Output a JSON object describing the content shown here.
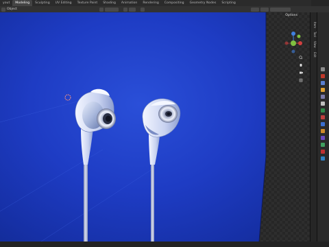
{
  "topbar": {
    "tabs": [
      {
        "label": "yout",
        "active": false
      },
      {
        "label": "Modeling",
        "active": true
      },
      {
        "label": "Sculpting",
        "active": false
      },
      {
        "label": "UV Editing",
        "active": false
      },
      {
        "label": "Texture Paint",
        "active": false
      },
      {
        "label": "Shading",
        "active": false
      },
      {
        "label": "Animation",
        "active": false
      },
      {
        "label": "Rendering",
        "active": false
      },
      {
        "label": "Compositing",
        "active": false
      },
      {
        "label": "Geometry Nodes",
        "active": false
      },
      {
        "label": "Scripting",
        "active": false
      }
    ],
    "right_label": "Sc"
  },
  "header": {
    "mode": "Object",
    "transform_orientation": "Global",
    "options_label": "Options"
  },
  "npanel": {
    "tabs": [
      "Item",
      "Tool",
      "View",
      "Edit"
    ]
  },
  "props": {
    "icon_colors": [
      "#8a8a8a",
      "#c0392b",
      "#5a7fd0",
      "#e0a030",
      "#7a7aaa",
      "#bfbfbf",
      "#2f8a4a",
      "#c04040",
      "#3a6fd0",
      "#d08a2a",
      "#6a4ac0",
      "#40a060",
      "#c03030",
      "#3080c0"
    ]
  },
  "colors": {
    "viewport_bg": "#1e3cc4",
    "axis_x": "#d04040",
    "axis_y": "#80c040",
    "axis_z": "#4080e0"
  },
  "icons": {
    "orientation": "navigation-gizmo",
    "zoom": "zoom-icon",
    "pan": "hand-pan-icon",
    "camera": "camera-icon",
    "grid": "grid-icon",
    "cursor": "3d-cursor-icon"
  }
}
